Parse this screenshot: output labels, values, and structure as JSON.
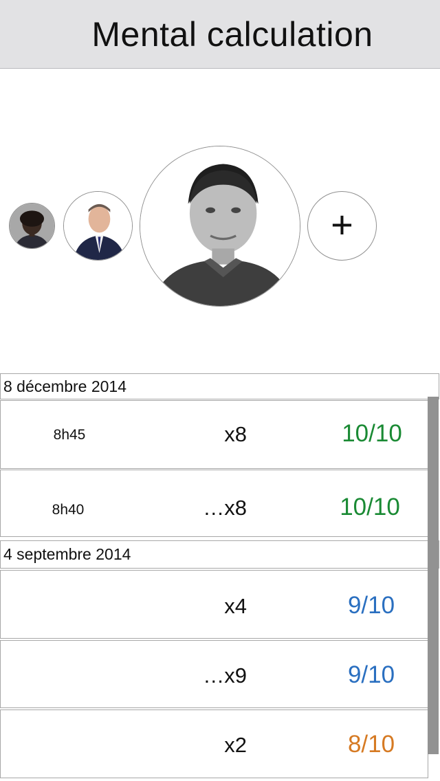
{
  "header": {
    "title": "Mental calculation"
  },
  "profiles": {
    "avatars": [
      {
        "name": "profile-avatar-1"
      },
      {
        "name": "profile-avatar-2"
      },
      {
        "name": "profile-avatar-selected"
      }
    ],
    "add_label": "+"
  },
  "sessions": [
    {
      "date": "8 décembre 2014",
      "rows": [
        {
          "time": "8h45",
          "label": "x8",
          "score": "10/10",
          "score_color": "#1a8a34"
        },
        {
          "time": "8h40",
          "label": "…x8",
          "score": "10/10",
          "score_color": "#1a8a34"
        }
      ]
    },
    {
      "date": "4 septembre 2014",
      "rows": [
        {
          "time": "",
          "label": "x4",
          "score": "9/10",
          "score_color": "#2a6fc0"
        },
        {
          "time": "",
          "label": "…x9",
          "score": "9/10",
          "score_color": "#2a6fc0"
        },
        {
          "time": "",
          "label": "x2",
          "score": "8/10",
          "score_color": "#d67a23"
        }
      ]
    }
  ]
}
